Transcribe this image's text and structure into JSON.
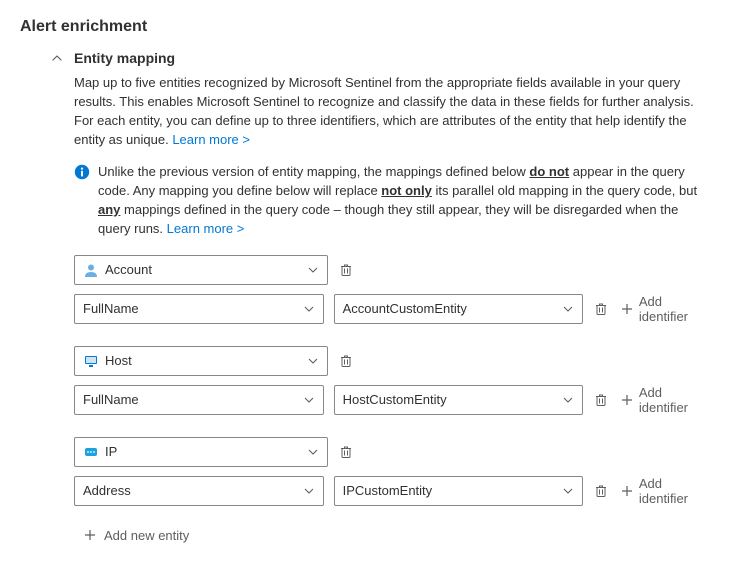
{
  "header": {
    "title": "Alert enrichment",
    "section_title": "Entity mapping"
  },
  "description": {
    "para1": "Map up to five entities recognized by Microsoft Sentinel from the appropriate fields available in your query results. This enables Microsoft Sentinel to recognize and classify the data in these fields for further analysis.",
    "para2": "For each entity, you can define up to three identifiers, which are attributes of the entity that help identify the entity as unique.",
    "learn_more": "Learn more >"
  },
  "info": {
    "pre1": "Unlike the previous version of entity mapping, the mappings defined below ",
    "em1": "do not",
    "mid1": " appear in the query code. Any mapping you define below will replace ",
    "em2": "not only",
    "mid2": " its parallel old mapping in the query code, but ",
    "em3": "any",
    "post": " mappings defined in the query code – though they still appear, they will be disregarded when the query runs.",
    "learn_more": "Learn more >"
  },
  "entities": [
    {
      "type": "Account",
      "identifier": "FullName",
      "target": "AccountCustomEntity"
    },
    {
      "type": "Host",
      "identifier": "FullName",
      "target": "HostCustomEntity"
    },
    {
      "type": "IP",
      "identifier": "Address",
      "target": "IPCustomEntity"
    }
  ],
  "buttons": {
    "add_identifier": "Add identifier",
    "add_entity": "Add new entity"
  },
  "colors": {
    "link": "#0078d4",
    "border": "#8a8886",
    "text": "#323130",
    "muted": "#605e5c"
  }
}
